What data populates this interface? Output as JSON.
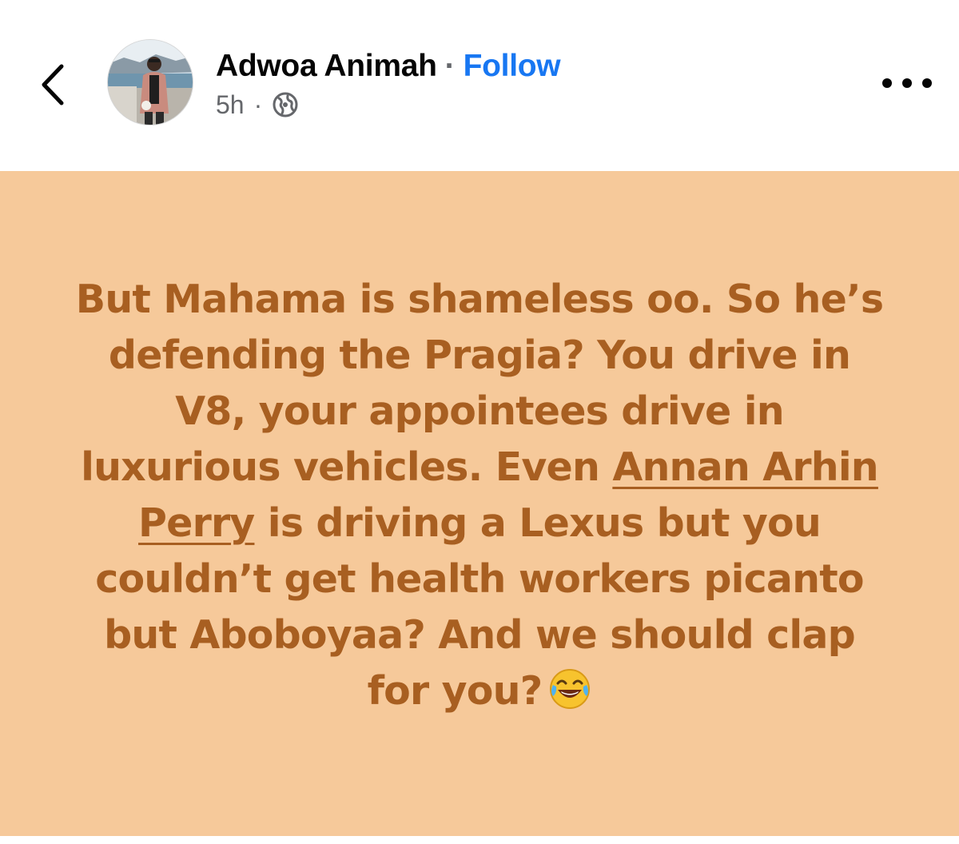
{
  "header": {
    "author_name": "Adwoa Animah",
    "separator": "·",
    "follow_label": "Follow",
    "timestamp": "5h",
    "meta_separator": "·",
    "privacy_icon": "globe-icon",
    "back_icon": "chevron-left-icon",
    "more_icon": "more-horizontal-icon"
  },
  "post": {
    "background_color": "#f6c99a",
    "text_color": "#a85f21",
    "text_before_mention": "But Mahama is shameless oo. So he’s defending the Pragia? You drive in V8, your appointees drive in luxurious vehicles. Even ",
    "mention": "Annan Arhin Perry",
    "text_after_mention": " is driving a Lexus but you couldn’t get health workers picanto but Aboboyaa? And we should clap for you?",
    "emoji": "face-with-tears-of-joy-icon"
  },
  "colors": {
    "follow_link": "#1877f2",
    "author_text": "#050505",
    "meta_text": "#65676b"
  }
}
